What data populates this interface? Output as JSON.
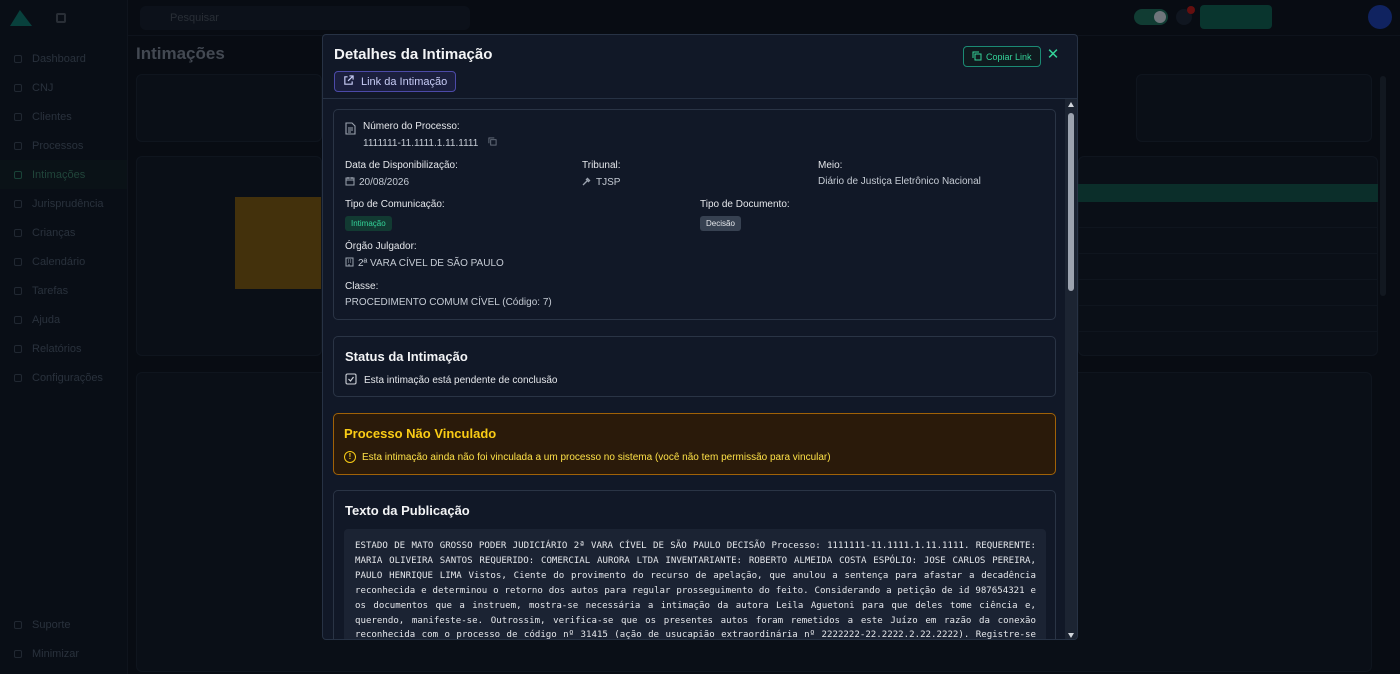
{
  "background": {
    "sidebar_items": [
      "Dashboard",
      "CNJ",
      "Clientes",
      "Processos",
      "Intimações",
      "Jurisprudência",
      "Crianças",
      "Calendário",
      "Tarefas",
      "Ajuda",
      "Relatórios",
      "Configurações"
    ],
    "sidebar_bottom": [
      "Suporte",
      "Minimizar"
    ],
    "search_placeholder": "Pesquisar",
    "page_title": "Intimações"
  },
  "modal": {
    "title": "Detalhes da Intimação",
    "link_button": "Link da Intimação",
    "copy_button": "Copiar Link",
    "details": {
      "numero_label": "Número do Processo:",
      "numero_value": "1111111-11.1111.1.11.1111",
      "data_label": "Data de Disponibilização:",
      "data_value": "20/08/2026",
      "tribunal_label": "Tribunal:",
      "tribunal_value": "TJSP",
      "meio_label": "Meio:",
      "meio_value": "Diário de Justiça Eletrônico Nacional",
      "tipo_com_label": "Tipo de Comunicação:",
      "tipo_com_value": "Intimação",
      "tipo_doc_label": "Tipo de Documento:",
      "tipo_doc_value": "Decisão",
      "orgao_label": "Órgão Julgador:",
      "orgao_value": "2ª VARA CÍVEL DE SÃO PAULO",
      "classe_label": "Classe:",
      "classe_value": "PROCEDIMENTO COMUM CÍVEL (Código: 7)"
    },
    "status": {
      "title": "Status da Intimação",
      "text": "Esta intimação está pendente de conclusão"
    },
    "warning": {
      "title": "Processo Não Vinculado",
      "text": "Esta intimação ainda não foi vinculada a um processo no sistema (você não tem permissão para vincular)"
    },
    "publication": {
      "title": "Texto da Publicação",
      "text": "ESTADO DE MATO GROSSO PODER JUDICIÁRIO 2ª VARA CÍVEL DE SÃO PAULO DECISÃO Processo: 1111111-11.1111.1.11.1111. REQUERENTE: MARIA OLIVEIRA SANTOS REQUERIDO: COMERCIAL AURORA LTDA INVENTARIANTE: ROBERTO ALMEIDA COSTA ESPÓLIO: JOSE CARLOS PEREIRA, PAULO HENRIQUE LIMA Vistos, Ciente do provimento do recurso de apelação, que anulou a sentença para afastar a decadência reconhecida e determinou o retorno dos autos para regular prosseguimento do feito. Considerando a petição de id 987654321 e os documentos que a instruem, mostra-se necessária a intimação da autora Leila Aguetoni para que deles tome ciência e, querendo, manifeste-se. Outrossim, verifica-se que os presentes autos foram remetidos a este Juízo em razão da conexão reconhecida com o processo de código nº 31415 (ação de usucapião extraordinária nº 2222222-22.2222.2.22.2222). Registre-se que, nos autos da referida ação de usucapião, foi reconhecida a"
    }
  }
}
